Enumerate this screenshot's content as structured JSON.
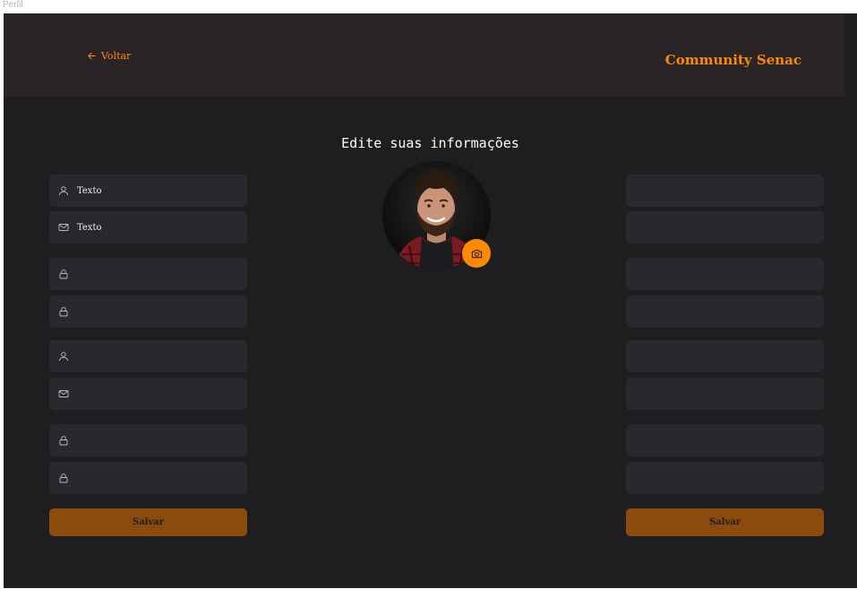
{
  "window": {
    "title": "Perfil"
  },
  "header": {
    "back_label": "Voltar",
    "brand": "Community Senac"
  },
  "page": {
    "title": "Edite suas informações"
  },
  "left_form": {
    "fields": [
      {
        "icon": "user-icon",
        "placeholder": "Texto"
      },
      {
        "icon": "mail-icon",
        "placeholder": "Texto"
      },
      {
        "icon": "lock-icon",
        "placeholder": ""
      },
      {
        "icon": "lock-icon",
        "placeholder": ""
      },
      {
        "icon": "user-icon",
        "placeholder": ""
      },
      {
        "icon": "mail-icon",
        "placeholder": ""
      },
      {
        "icon": "lock-icon",
        "placeholder": ""
      },
      {
        "icon": "lock-icon",
        "placeholder": ""
      }
    ],
    "save_label": "Salvar"
  },
  "right_form": {
    "save_label": "Salvar"
  },
  "avatar": {
    "action_icon": "camera-icon"
  },
  "colors": {
    "accent": "#ff8a00",
    "button": "#8c4a0e",
    "background": "#1e1e20",
    "header": "#2a2426",
    "field": "#29282d"
  }
}
